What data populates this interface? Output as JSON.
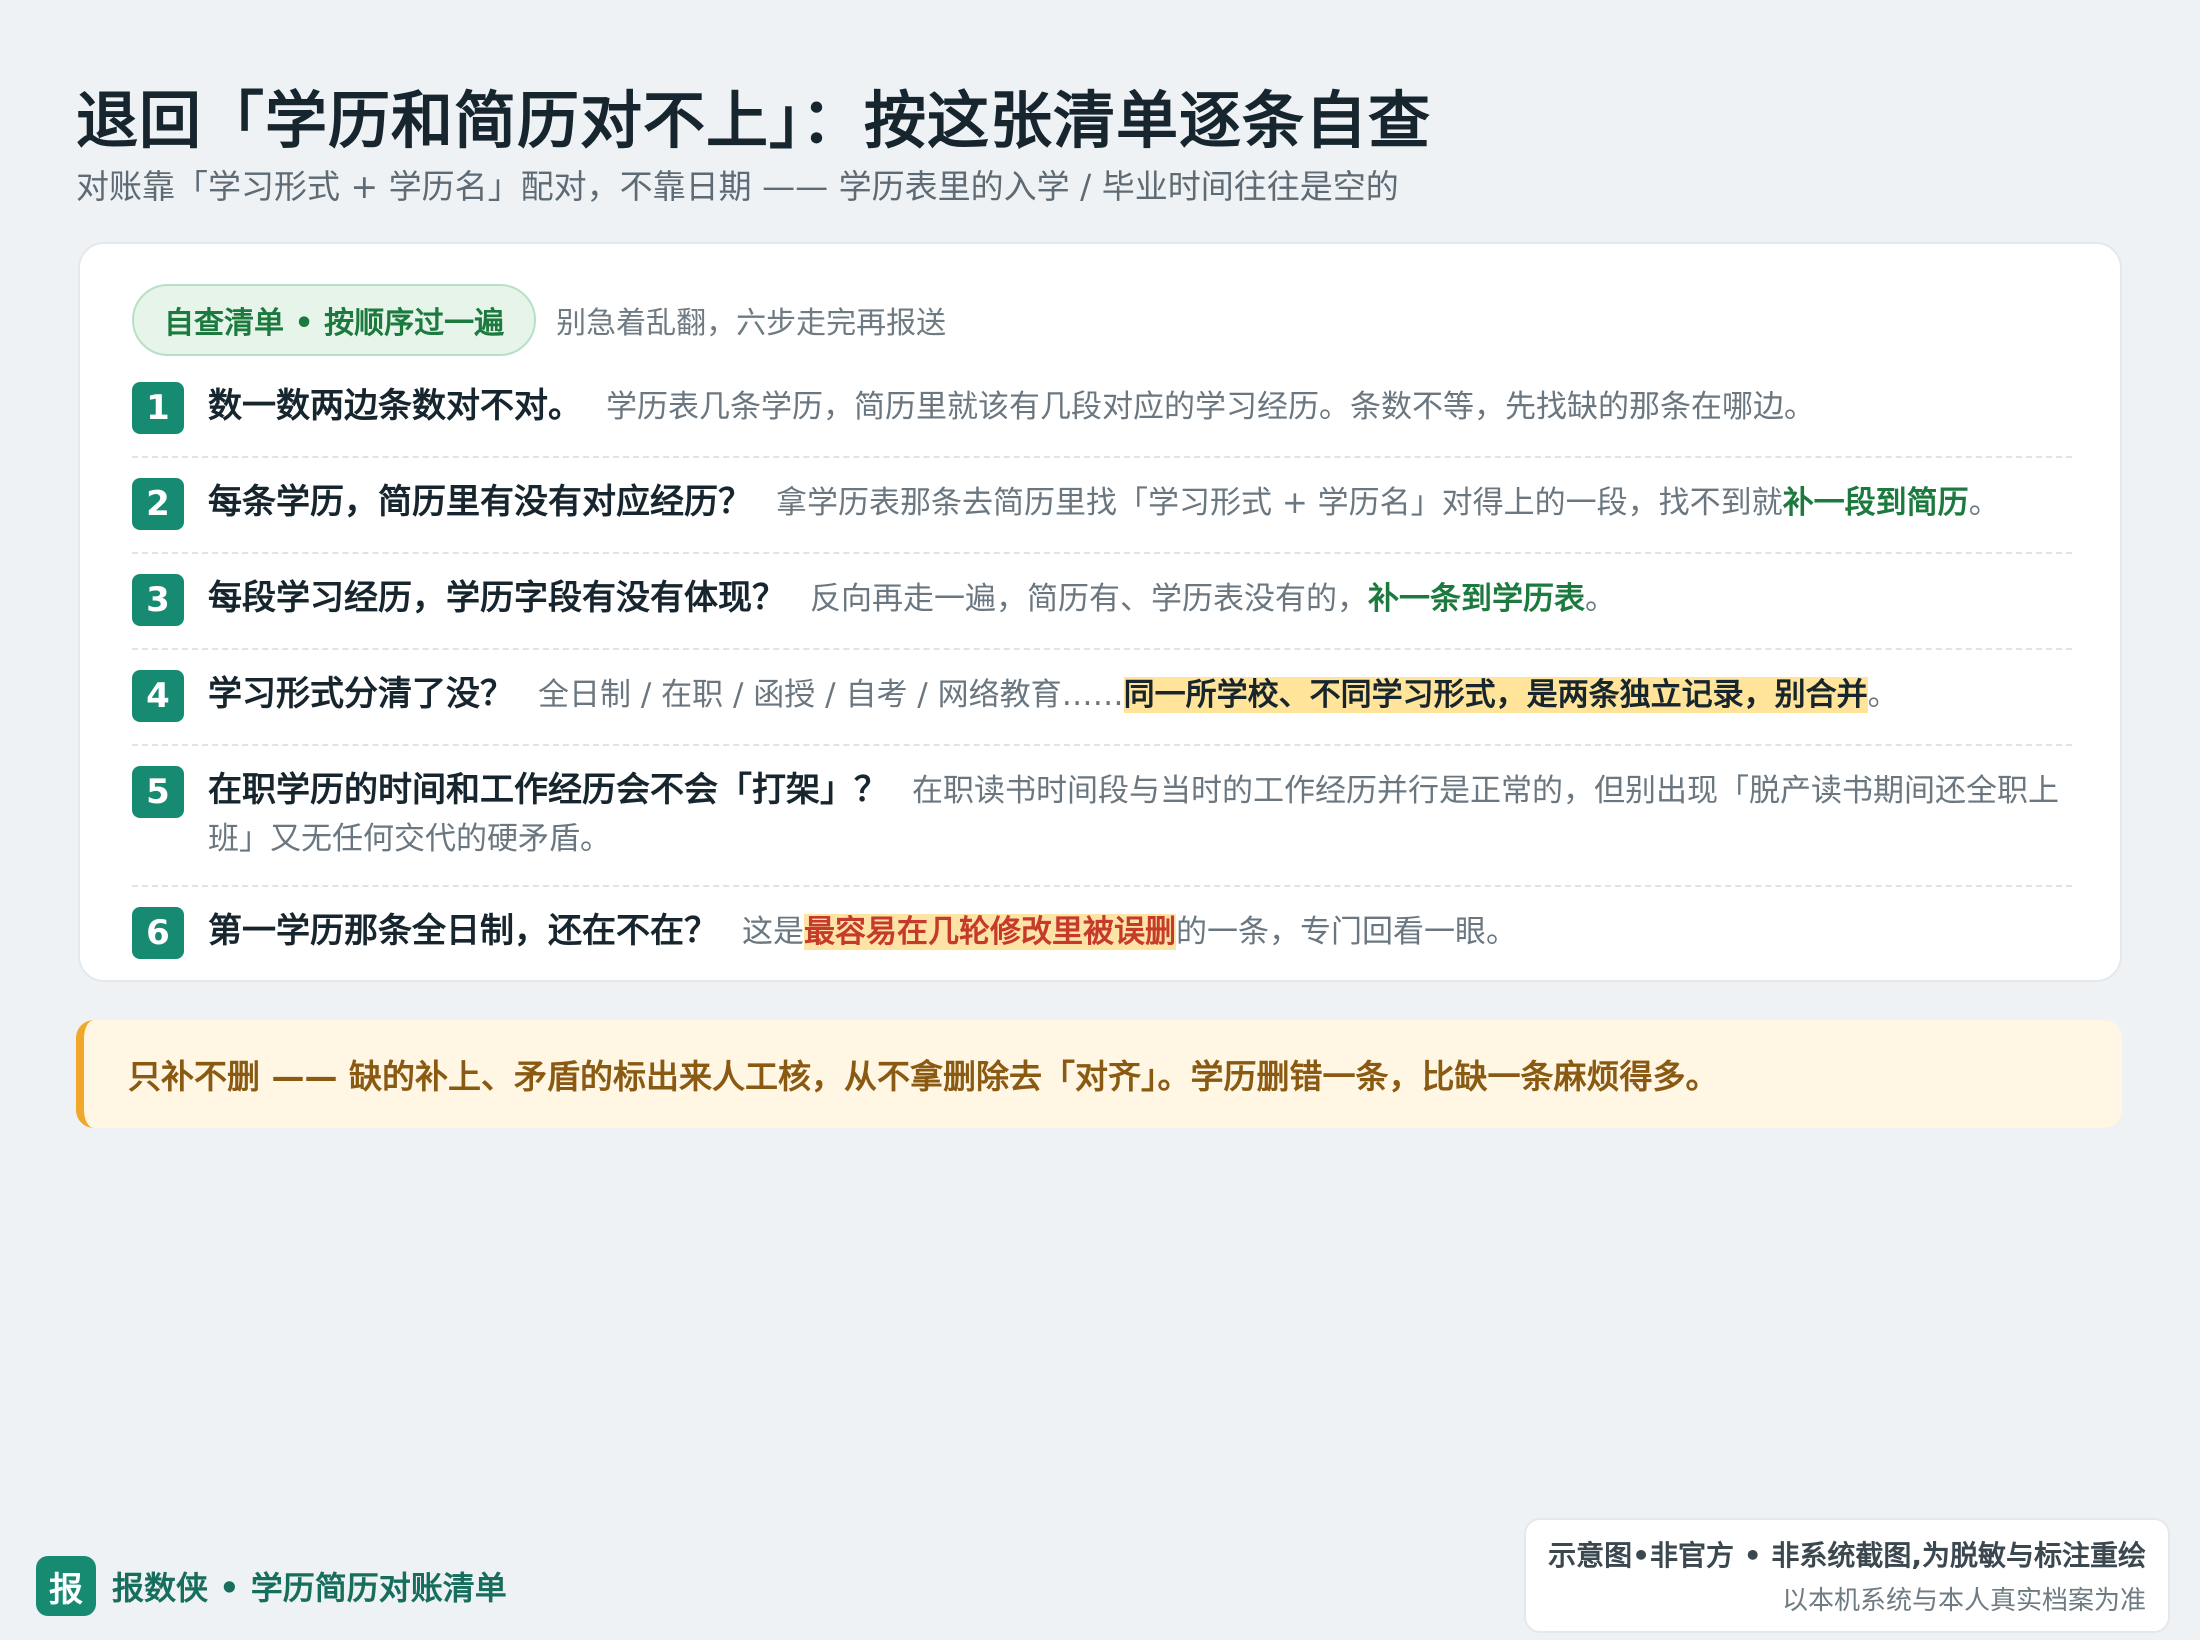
{
  "header": {
    "title": "退回「学历和简历对不上」：按这张清单逐条自查",
    "subtitle": "对账靠「学习形式 + 学历名」配对，不靠日期 —— 学历表里的入学 / 毕业时间往往是空的"
  },
  "checklist": {
    "badge": "自查清单 • 按顺序过一遍",
    "hint": "别急着乱翻，六步走完再报送",
    "steps": [
      {
        "num": "1",
        "question": "数一数两边条数对不对。",
        "text": "学历表几条学历，简历里就该有几段对应的学习经历。条数不等，先找缺的那条在哪边。"
      },
      {
        "num": "2",
        "question": "每条学历，简历里有没有对应经历？",
        "text": "拿学历表那条去简历里找「学习形式 + 学历名」对得上的一段，找不到就",
        "emphasis": "补一段到简历",
        "tail": "。"
      },
      {
        "num": "3",
        "question": "每段学习经历，学历字段有没有体现？",
        "text": "反向再走一遍，简历有、学历表没有的，",
        "emphasis": "补一条到学历表",
        "tail": "。"
      },
      {
        "num": "4",
        "question": "学习形式分清了没？",
        "text": "全日制 / 在职 / 函授 / 自考 / 网络教育……",
        "emphasis": "同一所学校、不同学习形式，是两条独立记录，别合并",
        "tail": "。"
      },
      {
        "num": "5",
        "question": "在职学历的时间和工作经历会不会「打架」？",
        "text": "在职读书时间段与当时的工作经历并行是正常的，但别出现「脱产读书期间还全职上班」又无任何交代的硬矛盾。"
      },
      {
        "num": "6",
        "question": "第一学历那条全日制，还在不在？",
        "text": "这是",
        "emphasis": "最容易在几轮修改里被误删",
        "tail": "的一条，专门回看一眼。"
      }
    ]
  },
  "note": {
    "text": "只补不删 —— 缺的补上、矛盾的标出来人工核，从不拿删除去「对齐」。学历删错一条，比缺一条麻烦得多。"
  },
  "footer": {
    "brand_icon": "报",
    "brand_text": "报数侠 • 学历简历对账清单",
    "disclaimer_line1": "示意图•非官方 • 非系统截图,为脱敏与标注重绘",
    "disclaimer_line2": "以本机系统与本人真实档案为准"
  }
}
